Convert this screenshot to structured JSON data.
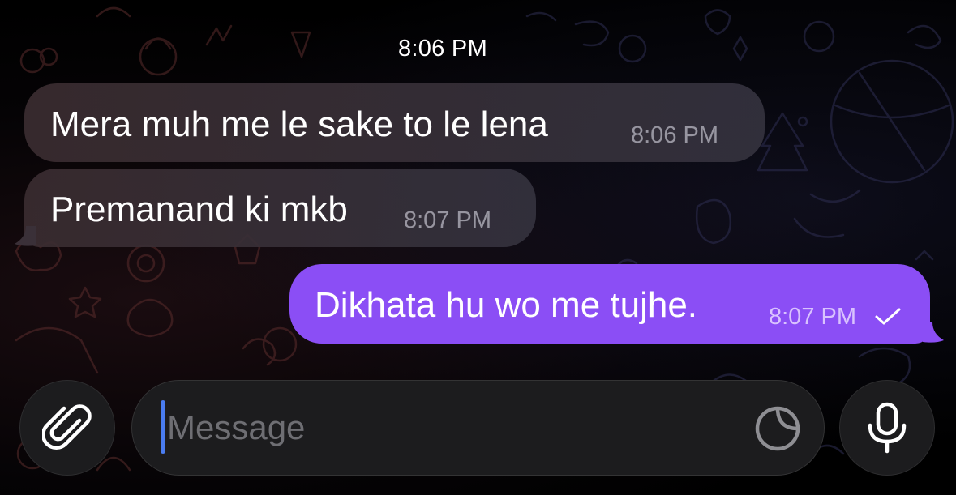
{
  "chat": {
    "date_label": "8:06 PM",
    "messages": [
      {
        "direction": "incoming",
        "text": "Mera muh me le sake to le lena",
        "time": "8:06 PM"
      },
      {
        "direction": "incoming",
        "text": "Premanand ki mkb",
        "time": "8:07 PM"
      },
      {
        "direction": "outgoing",
        "text": "Dikhata hu wo me tujhe.",
        "time": "8:07 PM",
        "status": "sent-check"
      }
    ]
  },
  "composer": {
    "placeholder": "Message",
    "attach_icon": "paperclip-icon",
    "sticker_icon": "sticker-icon",
    "mic_icon": "microphone-icon"
  },
  "colors": {
    "outgoing_bubble": "#8b4ef5",
    "incoming_bubble": "#3a2f37",
    "caret": "#4a7cf0",
    "background": "#000000"
  }
}
